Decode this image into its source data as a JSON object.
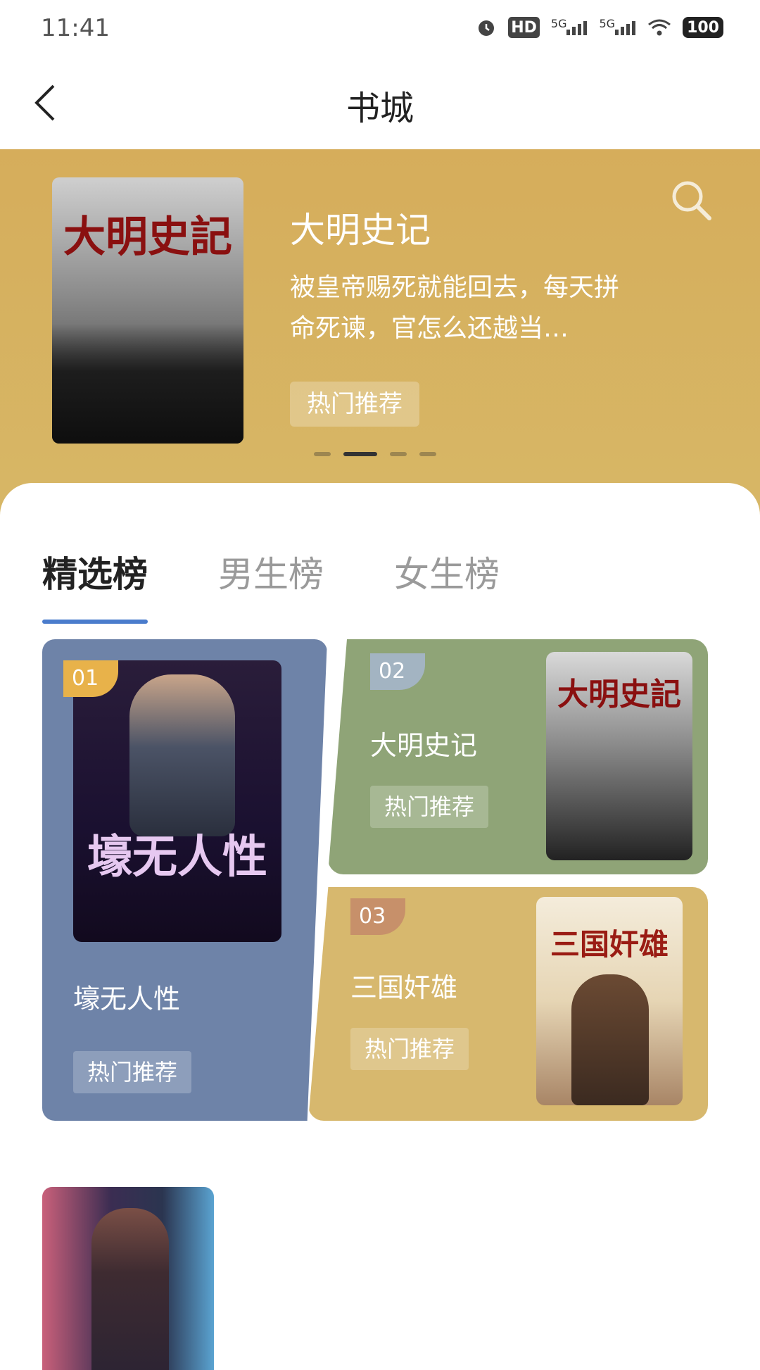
{
  "status_bar": {
    "time": "11:41",
    "icons": [
      "alarm-icon",
      "hd-icon",
      "5g-signal-icon",
      "5g-signal-icon",
      "wifi-icon"
    ],
    "hd_label": "HD",
    "signal_1": "5G",
    "signal_2": "5G",
    "battery": "100"
  },
  "header": {
    "title": "书城",
    "back_icon": "back-arrow-icon"
  },
  "hero": {
    "book_title": "大明史记",
    "cover_title": "大明史記",
    "description": "被皇帝赐死就能回去，每天拼命死谏，官怎么还越当…",
    "tag": "热门推荐",
    "search_icon": "search-icon",
    "carousel": {
      "count": 4,
      "active_index": 1
    }
  },
  "tabs": [
    {
      "label": "精选榜",
      "active": true
    },
    {
      "label": "男生榜",
      "active": false
    },
    {
      "label": "女生榜",
      "active": false
    }
  ],
  "ranking": [
    {
      "rank": "01",
      "title": "壕无人性",
      "cover_title": "壕无人性",
      "tag": "热门推荐",
      "color": "#6e83a8"
    },
    {
      "rank": "02",
      "title": "大明史记",
      "cover_title": "大明史記",
      "tag": "热门推荐",
      "color": "#8fa477"
    },
    {
      "rank": "03",
      "title": "三国奸雄",
      "cover_title": "三国奸雄",
      "tag": "热门推荐",
      "color": "#d7b86e"
    }
  ],
  "colors": {
    "hero_bg": "#d6ad5b",
    "tab_indicator": "#4a7ccc"
  }
}
